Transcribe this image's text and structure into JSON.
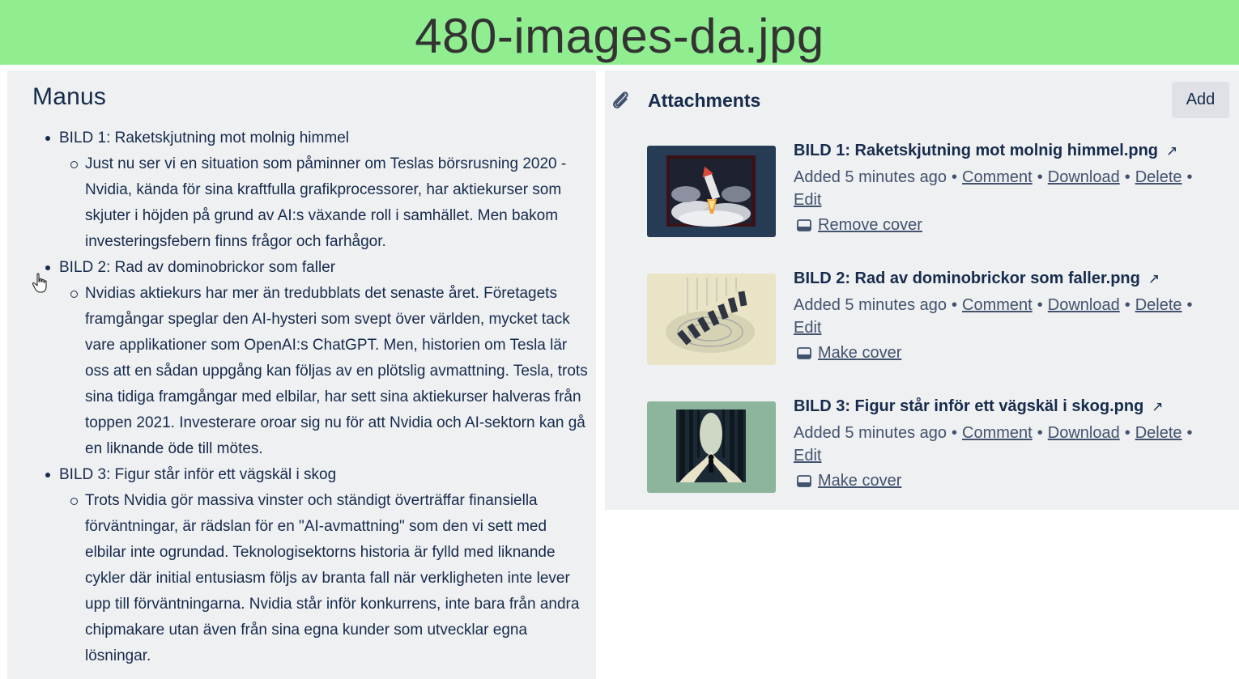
{
  "banner": {
    "title": "480-images-da.jpg",
    "color": "#90ee90"
  },
  "manus": {
    "title": "Manus",
    "items": [
      {
        "label": "BILD 1: Raketskjutning mot molnig himmel",
        "text": "Just nu ser vi en situation som påminner om Teslas börsrusning 2020 - Nvidia, kända för sina kraftfulla grafikprocessorer, har aktiekurser som skjuter i höjden på grund av AI:s växande roll i samhället. Men bakom investeringsfebern finns frågor och farhågor."
      },
      {
        "label": "BILD 2: Rad av dominobrickor som faller",
        "text": "Nvidias aktiekurs har mer än tredubblats det senaste året. Företagets framgångar speglar den AI-hysteri som svept över världen, mycket tack vare applikationer som OpenAI:s ChatGPT. Men, historien om Tesla lär oss att en sådan uppgång kan följas av en plötslig avmattning. Tesla, trots sina tidiga framgångar med elbilar, har sett sina aktiekurser halveras från toppen 2021. Investerare oroar sig nu för att Nvidia och AI-sektorn kan gå en liknande öde till mötes."
      },
      {
        "label": "BILD 3: Figur står inför ett vägskäl i skog",
        "text": "Trots Nvidia gör massiva vinster och ständigt överträffar finansiella förväntningar, är rädslan för en \"AI-avmattning\" som den vi sett med elbilar inte ogrundad. Teknologisektorns historia är fylld med liknande cykler där initial entusiasm följs av branta fall när verkligheten inte lever upp till förväntningarna. Nvidia står inför konkurrens, inte bara från andra chipmakare utan även från sina egna kunder som utvecklar egna lösningar."
      }
    ]
  },
  "attachments": {
    "title": "Attachments",
    "add_label": "Add",
    "actions": {
      "comment": "Comment",
      "download": "Download",
      "delete": "Delete",
      "edit": "Edit"
    },
    "separator": "•",
    "external_icon": "↗",
    "items": [
      {
        "name": "BILD 1: Raketskjutning mot molnig himmel.png",
        "added": "Added 5 minutes ago",
        "cover_label": "Remove cover",
        "thumb_icon": "rocket-launch-thumbnail"
      },
      {
        "name": "BILD 2: Rad av dominobrickor som faller.png",
        "added": "Added 5 minutes ago",
        "cover_label": "Make cover",
        "thumb_icon": "falling-dominoes-thumbnail"
      },
      {
        "name": "BILD 3: Figur står inför ett vägskäl i skog.png",
        "added": "Added 5 minutes ago",
        "cover_label": "Make cover",
        "thumb_icon": "forest-crossroads-thumbnail"
      }
    ]
  }
}
